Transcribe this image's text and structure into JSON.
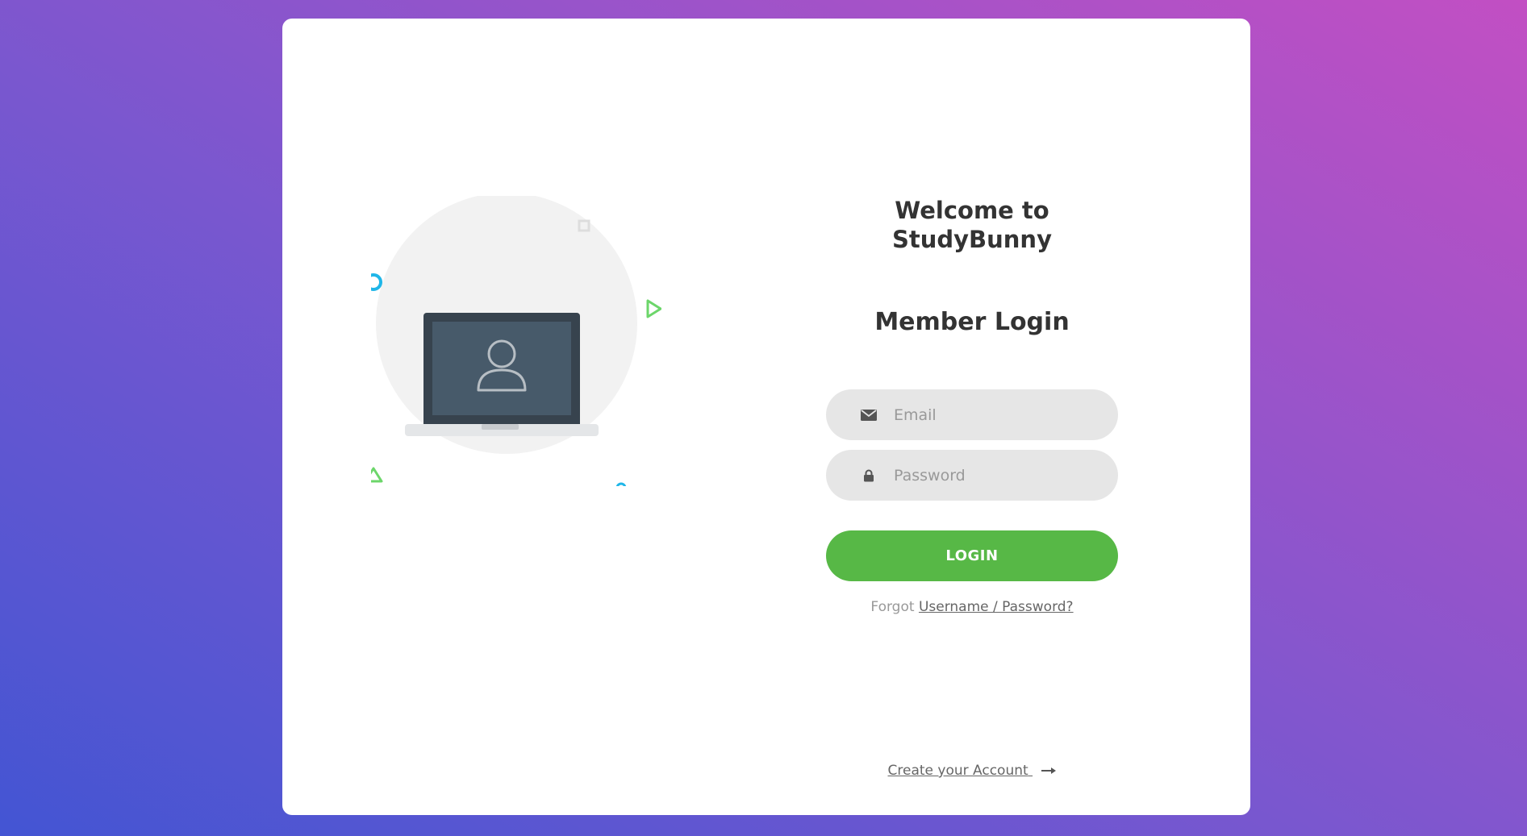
{
  "welcome": {
    "line1": "Welcome to",
    "line2": "StudyBunny"
  },
  "login": {
    "title": "Member Login",
    "email_placeholder": "Email",
    "password_placeholder": "Password",
    "button_label": "LOGIN",
    "forgot_prefix": "Forgot",
    "forgot_link": "Username / Password?",
    "create_account_label": "Create your Account"
  },
  "icons": {
    "email": "envelope-icon",
    "password": "lock-icon",
    "create_account": "arrow-right-icon",
    "illustration": "laptop-user-illustration"
  },
  "colors": {
    "background_start": "#4355d3",
    "background_end": "#c24fc3",
    "login_button": "#57b846",
    "input_background": "#e6e6e6",
    "accent_blue": "#1fb6e8",
    "accent_green": "#6cd66a"
  }
}
